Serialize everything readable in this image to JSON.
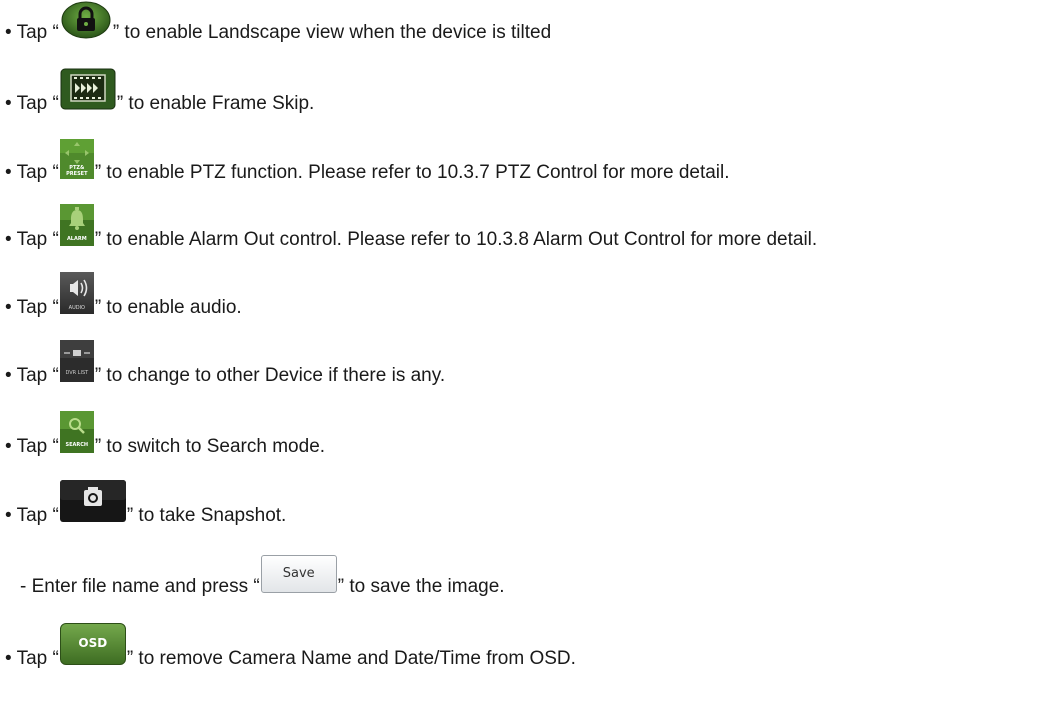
{
  "items": [
    {
      "prefix": "• Tap “",
      "suffix": "” to enable Landscape view when the device is tilted",
      "icon": "lock-icon"
    },
    {
      "prefix": "• Tap “",
      "suffix": "” to enable Frame Skip.",
      "icon": "frame-skip-icon"
    },
    {
      "prefix": "• Tap “",
      "suffix": "” to enable PTZ function. Please refer to 10.3.7 PTZ Control for more detail.",
      "icon": "ptz-preset-icon",
      "icon_label": "PTZ& PRESET"
    },
    {
      "prefix": "• Tap “",
      "suffix": "” to enable Alarm Out control. Please refer to 10.3.8 Alarm Out Control for more detail.",
      "icon": "alarm-bell-icon",
      "icon_label": "ALARM"
    },
    {
      "prefix": "• Tap “",
      "suffix": "” to enable audio.",
      "icon": "audio-speaker-icon",
      "icon_label": "AUDIO"
    },
    {
      "prefix": "• Tap “",
      "suffix": "” to change to other Device if there is any.",
      "icon": "dvr-list-icon",
      "icon_label": "DVR LIST"
    },
    {
      "prefix": "• Tap “",
      "suffix": "” to switch to Search mode.",
      "icon": "search-icon",
      "icon_label": "SEARCH"
    },
    {
      "prefix": "• Tap “",
      "suffix": "” to take Snapshot.",
      "icon": "camera-snapshot-icon"
    },
    {
      "prefix": "- Enter file name and press “",
      "suffix": "” to save the image.",
      "icon": "save-button",
      "icon_label": "Save"
    },
    {
      "prefix": "• Tap “",
      "suffix": "” to remove Camera Name and Date/Time from OSD.",
      "icon": "osd-button",
      "icon_label": "OSD"
    }
  ],
  "colors": {
    "green_dark": "#2f5a1f",
    "green_mid": "#5f9a3a",
    "gray_dark": "#3a3a3a",
    "black": "#161616"
  }
}
